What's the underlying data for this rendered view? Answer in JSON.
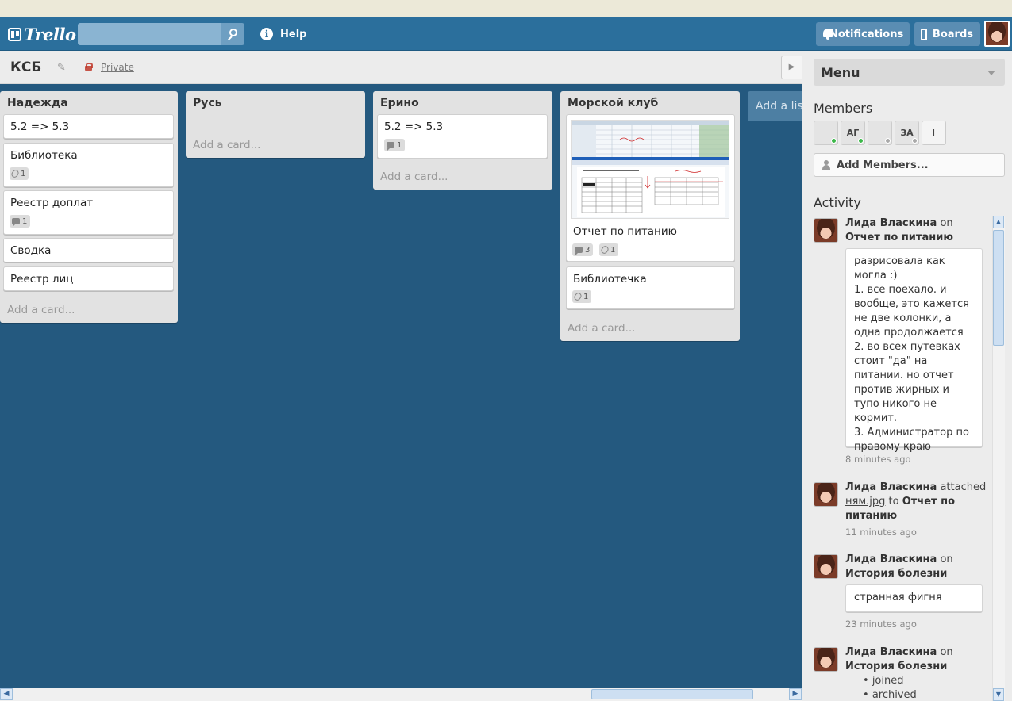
{
  "header": {
    "logo_text": "Trello",
    "search_placeholder": "",
    "help_label": "Help",
    "notifications_label": "Notifications",
    "boards_label": "Boards"
  },
  "board": {
    "title": "КСБ",
    "visibility": "Private",
    "add_list_label": "Add a list..."
  },
  "lists": [
    {
      "title": "Надежда",
      "cards": [
        {
          "title": "5.2 => 5.3"
        },
        {
          "title": "Библиотека",
          "badge_attach": "1"
        },
        {
          "title": "Реестр доплат",
          "badge_comments": "1"
        },
        {
          "title": "Сводка"
        },
        {
          "title": "Реестр лиц"
        }
      ],
      "add_card": "Add a card..."
    },
    {
      "title": "Русь",
      "cards": [],
      "add_card": "Add a card..."
    },
    {
      "title": "Ерино",
      "cards": [
        {
          "title": "5.2 => 5.3",
          "badge_comments": "1"
        }
      ],
      "add_card": "Add a card..."
    },
    {
      "title": "Морской клуб",
      "cards": [
        {
          "title": "Отчет по питанию",
          "badge_comments": "3",
          "badge_attach": "1"
        },
        {
          "title": "Библиотечка",
          "badge_attach": "1"
        }
      ],
      "add_card": "Add a card..."
    }
  ],
  "sidebar": {
    "menu_label": "Menu",
    "members_title": "Members",
    "members": [
      {
        "type": "photo"
      },
      {
        "initials": "АГ"
      },
      {
        "type": "photo-green"
      },
      {
        "initials": "ЗА"
      },
      {
        "initials": "I"
      }
    ],
    "add_members_label": "Add Members...",
    "activity_title": "Activity",
    "activity": [
      {
        "user": "Лида Власкина",
        "verb": "on",
        "target": "Отчет по питанию",
        "comment": "разрисовала как могла :)\n1. все поехало. и вообще, это кажется не две колонки, а одна продолжается\n2. во всех путевках стоит \"да\" на питании. но отчет против жирных и тупо никого не кормит.\n3. Администратор по правому краю",
        "time": "8 minutes ago"
      },
      {
        "user": "Лида Власкина",
        "verb": "attached",
        "file": "ням.jpg",
        "to": "to",
        "target": "Отчет по питанию",
        "time": "11 minutes ago"
      },
      {
        "user": "Лида Власкина",
        "verb": "on",
        "target": "История болезни",
        "comment": "странная фигня",
        "time": "23 minutes ago"
      },
      {
        "user": "Лида Власкина",
        "verb": "on",
        "target": "История болезни",
        "items": [
          "joined",
          "archived"
        ]
      }
    ]
  },
  "colors": {
    "board_bg": "#24597f",
    "header_bg": "#2b6f9c",
    "list_bg": "#e2e2e2",
    "sidebar_bg": "#ececec"
  }
}
